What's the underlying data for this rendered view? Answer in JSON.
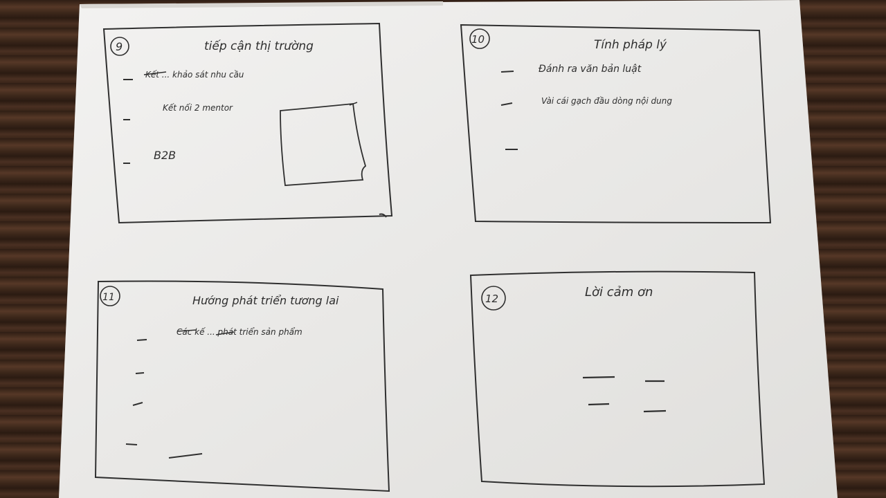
{
  "sketch": {
    "panel_9": {
      "number": "9",
      "title": "tiếp cận thị trường",
      "bullets": [
        "Kết ... khảo sát nhu cầu",
        "Kết nối 2 mentor",
        "B2B"
      ]
    },
    "panel_10": {
      "number": "10",
      "title": "Tính pháp lý",
      "bullets": [
        "Đánh ra văn bản luật",
        "Vài cái gạch đầu dòng nội dung"
      ]
    },
    "panel_11": {
      "number": "11",
      "title": "Hướng phát triển tương lai",
      "bullets": [
        "Các kế ... phát triển sản phẩm"
      ]
    },
    "panel_12": {
      "number": "12",
      "title": "Lời cảm ơn"
    }
  }
}
